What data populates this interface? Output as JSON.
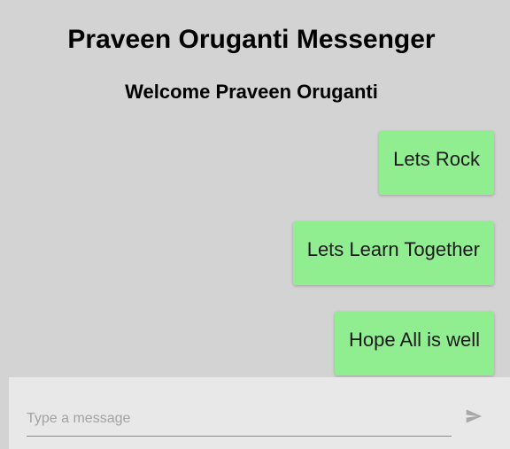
{
  "header": {
    "title": "Praveen Oruganti Messenger",
    "welcome": "Welcome Praveen Oruganti"
  },
  "messages": [
    {
      "text": "Lets Rock"
    },
    {
      "text": "Lets Learn Together"
    },
    {
      "text": "Hope All is well"
    }
  ],
  "composer": {
    "placeholder": "Type a message",
    "value": "",
    "send_icon": "send-icon"
  },
  "colors": {
    "background": "#d3d3d3",
    "bubble": "#90ee90",
    "composer_background": "#e8e8e9",
    "send_icon": "#a8a8a8"
  }
}
